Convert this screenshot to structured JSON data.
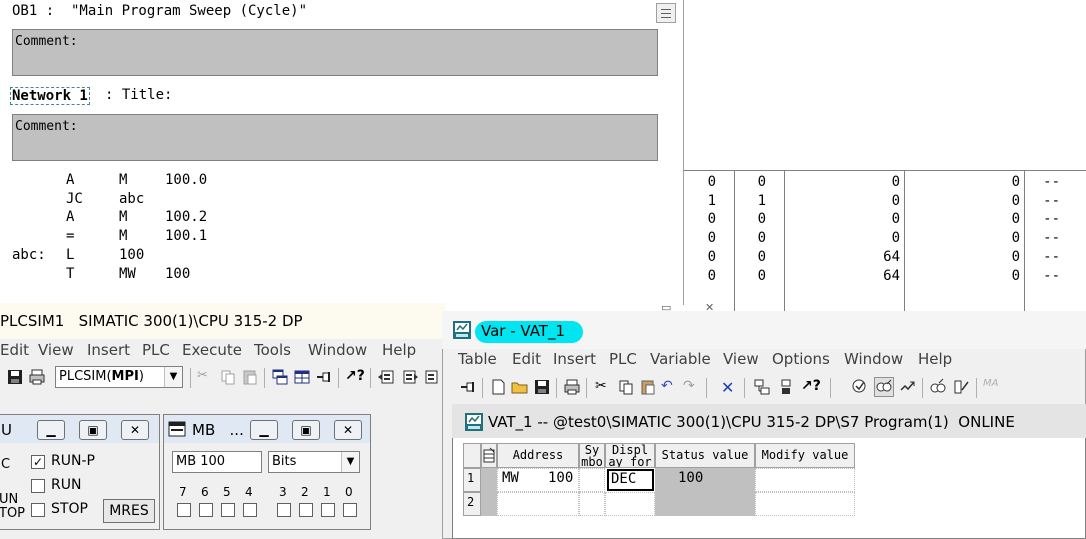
{
  "editor": {
    "ob_title": "OB1 :  \"Main Program Sweep (Cycle)\"",
    "comment_label": "Comment:",
    "network_label": "Network 1",
    "network_title": ": Title:",
    "comment2_label": "Comment:",
    "stl": [
      {
        "label": "",
        "op": "A",
        "operand": "M",
        "addr": "100.0"
      },
      {
        "label": "",
        "op": "JC",
        "operand": "abc",
        "addr": ""
      },
      {
        "label": "",
        "op": "A",
        "operand": "M",
        "addr": "100.2"
      },
      {
        "label": "",
        "op": "=",
        "operand": "M",
        "addr": "100.1"
      },
      {
        "label": "abc:",
        "op": "L",
        "operand": "100",
        "addr": ""
      },
      {
        "label": "",
        "op": "T",
        "operand": "MW",
        "addr": "100"
      }
    ]
  },
  "status_grid": {
    "rows": [
      [
        "0",
        "0",
        "0",
        "0",
        "--"
      ],
      [
        "1",
        "1",
        "0",
        "0",
        "--"
      ],
      [
        "0",
        "0",
        "0",
        "0",
        "--"
      ],
      [
        "0",
        "0",
        "0",
        "0",
        "--"
      ],
      [
        "0",
        "0",
        "64",
        "0",
        "--"
      ],
      [
        "0",
        "0",
        "64",
        "0",
        "--"
      ]
    ]
  },
  "plcsim": {
    "title": "PLCSIM1   SIMATIC 300(1)\\CPU 315-2 DP",
    "menu": [
      "Edit",
      "View",
      "Insert",
      "PLC",
      "Execute",
      "Tools",
      "Window",
      "Help"
    ],
    "combo_prefix": "PLCSIM(",
    "combo_bold": "MPI",
    "combo_suffix": ")",
    "cpu_panel": {
      "title": "U",
      "side_letters": [
        "C",
        "UN",
        "TOP"
      ],
      "run_p": "RUN-P",
      "run": "RUN",
      "stop": "STOP",
      "mres": "MRES",
      "run_p_checked": true
    },
    "mb_panel": {
      "title": "MB   ...",
      "address": "MB  100",
      "format": "Bits",
      "bits": [
        "7",
        "6",
        "5",
        "4",
        "3",
        "2",
        "1",
        "0"
      ]
    }
  },
  "vat": {
    "title": "Var - VAT_1",
    "menu": [
      "Table",
      "Edit",
      "Insert",
      "PLC",
      "Variable",
      "View",
      "Options",
      "Window",
      "Help"
    ],
    "inner_title": "VAT_1 -- @test0\\SIMATIC 300(1)\\CPU 315-2 DP\\S7 Program(1)  ONLINE",
    "columns": [
      "Address",
      "Sy mbo",
      "Displ ay for",
      "Status value",
      "Modify value"
    ],
    "rows": [
      {
        "num": "1",
        "address": "MW",
        "addr_num": "100",
        "symbol": "",
        "display": "DEC",
        "status": "100",
        "modify": ""
      },
      {
        "num": "2",
        "address": "",
        "addr_num": "",
        "symbol": "",
        "display": "",
        "status": "",
        "modify": ""
      }
    ]
  }
}
